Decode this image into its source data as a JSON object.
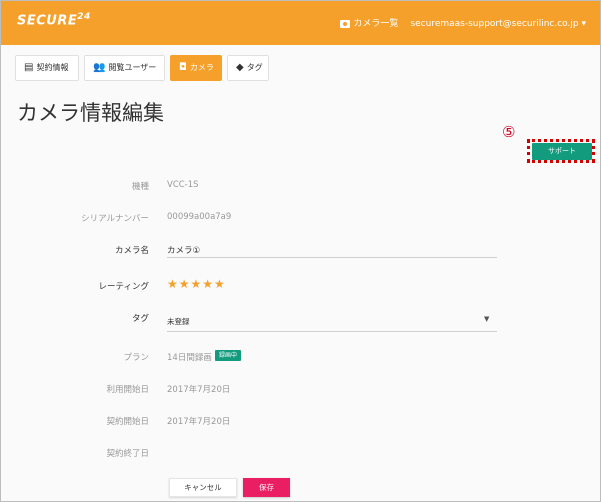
{
  "header": {
    "logo": "SECURE",
    "logo_sup": "24",
    "camera_list_link": "カメラ一覧",
    "user_email": "securemaas-support@securilinc.co.jp"
  },
  "tabs": [
    {
      "icon": "contract-icon",
      "label": "契約情報",
      "active": false
    },
    {
      "icon": "users-icon",
      "label": "閲覧ユーザー",
      "active": false
    },
    {
      "icon": "camera-icon",
      "label": "カメラ",
      "active": true
    },
    {
      "icon": "tag-icon",
      "label": "タグ",
      "active": false
    }
  ],
  "page_title": "カメラ情報編集",
  "annotation_number": "⑤",
  "support_button": "サポート",
  "fields": {
    "model": {
      "label": "機種",
      "value": "VCC-1S"
    },
    "serial": {
      "label": "シリアルナンバー",
      "value": "00099a00a7a9"
    },
    "camera_name": {
      "label": "カメラ名",
      "value": "カメラ①"
    },
    "rating": {
      "label": "レーティング",
      "value": "★★★★★",
      "stars": 5
    },
    "tag": {
      "label": "タグ",
      "value": "未登録"
    },
    "plan": {
      "label": "プラン",
      "value": "14日間録画",
      "badge": "録画中"
    },
    "usage_start": {
      "label": "利用開始日",
      "value": "2017年7月20日"
    },
    "contract_start": {
      "label": "契約開始日",
      "value": "2017年7月20日"
    },
    "contract_end": {
      "label": "契約終了日",
      "value": ""
    }
  },
  "buttons": {
    "cancel": "キャンセル",
    "save": "保存"
  },
  "colors": {
    "accent": "#f5a02b",
    "support": "#139b7e",
    "save": "#e91e63",
    "annotation": "#d40000"
  }
}
